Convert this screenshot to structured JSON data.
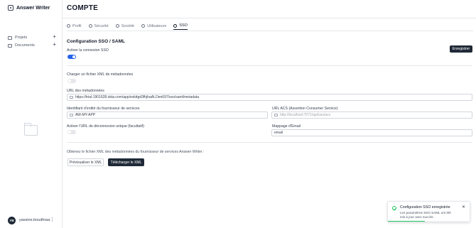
{
  "app": {
    "name": "Answer Writer"
  },
  "sidebar": {
    "items": [
      {
        "label": "Projets",
        "icon": "folder-icon"
      },
      {
        "label": "Documents",
        "icon": "file-icon"
      }
    ],
    "user": {
      "initials": "YB",
      "name": "yassine.boudhraa"
    }
  },
  "page": {
    "title": "COMPTE"
  },
  "tabs": [
    {
      "label": "Profil",
      "icon": "user-icon"
    },
    {
      "label": "Sécurité",
      "icon": "lock-icon"
    },
    {
      "label": "Société",
      "icon": "building-icon"
    },
    {
      "label": "Utilisateurs",
      "icon": "users-icon"
    },
    {
      "label": "SSO",
      "icon": "key-icon",
      "active": true
    }
  ],
  "sso": {
    "section_title": "Configuration SSO / SAML",
    "save_label": "Enregistrer",
    "enable_label": "Activer la connexion SSO",
    "enable_on": true,
    "upload_xml_label": "Charger un fichier XML de métadonnées",
    "upload_xml_on": false,
    "metadata_url_label": "URL des métadonnées",
    "metadata_url_value": "https://trial-1901628.okta.com/app/exkttgd3fhjhaALOen697/sso/saml/metadata",
    "entity_id_label": "Identifiant d'entité du fournisseur de services",
    "entity_id_value": "AW-MY-APP",
    "acs_url_label": "URL ACS (Assertion Consumer Service)",
    "acs_url_placeholder": "http://localhost:7071/api/sso/acs",
    "logout_label": "Activer l'URL de déconnexion unique (facultatif)",
    "logout_on": false,
    "email_mapping_label": "Mappage d'Email",
    "email_mapping_value": "email",
    "xml_note": "Obtenez le fichier XML des métadonnées du fournisseur de services Answer Writer :",
    "preview_label": "Prévisualiser le XML",
    "download_label": "Télécharger le XML"
  },
  "toast": {
    "title": "Configuration SSO enregistrée",
    "body": "Les paramètres SSO SAML ont été mis à jour avec succès.",
    "progress": 0.45,
    "accent": "#22c55e"
  },
  "colors": {
    "accent": "#2563eb",
    "dark": "#1f2937"
  }
}
